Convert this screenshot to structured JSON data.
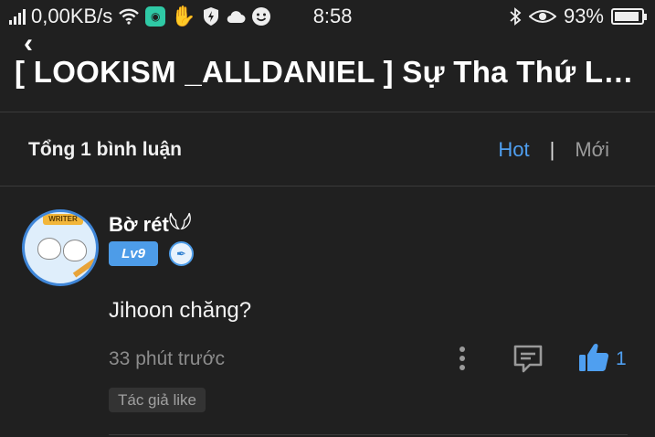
{
  "status_bar": {
    "network_speed": "0,00KB/s",
    "time": "8:58",
    "battery": "93%",
    "battery_level": 0.93,
    "icons": [
      "signal-icon",
      "wifi-icon",
      "app-notification-icon",
      "hand-icon",
      "shield-icon",
      "cloud-icon",
      "smiley-icon",
      "bluetooth-icon",
      "eye-icon",
      "battery-icon"
    ]
  },
  "top_bar": {
    "title": "[ LOOKISM _ALLDANIEL ] Sự Tha Thứ Lỗi..."
  },
  "comments_header": {
    "count_label": "Tổng 1 bình luận",
    "sort_hot": "Hot",
    "sort_separator": "|",
    "sort_new": "Mới",
    "accent_color": "#4f9ff0"
  },
  "comment": {
    "username": "Bờ rét𓆩𓆪",
    "avatar_banner": "WRITER",
    "level_badge": "Lv9",
    "content": "Jihoon chăng?",
    "timestamp": "33 phút trước",
    "like_count": "1",
    "author_liked_label": "Tác giả like"
  }
}
